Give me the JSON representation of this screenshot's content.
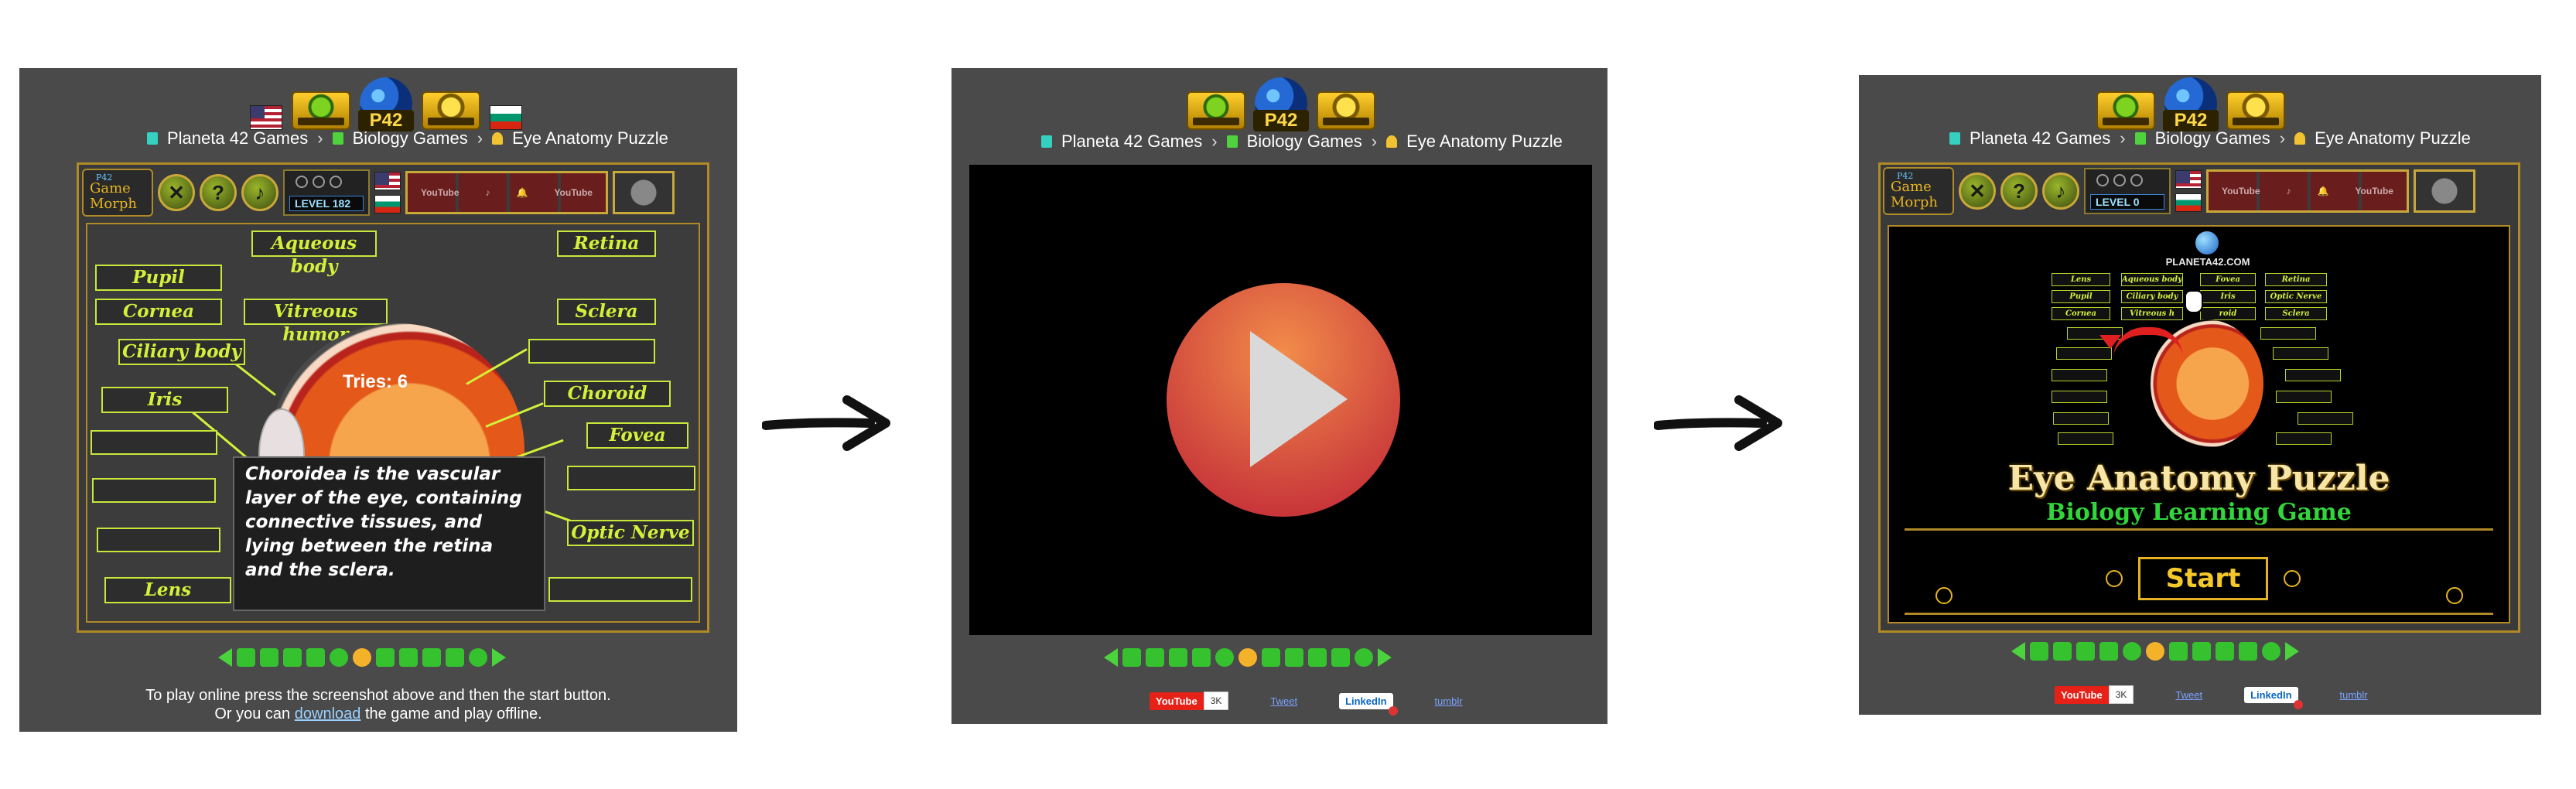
{
  "breadcrumb": {
    "item1": "Planeta 42 Games",
    "item2": "Biology Games",
    "item3": "Eye Anatomy Puzzle",
    "sep": "›"
  },
  "logo_text": "P42",
  "gamemorph": {
    "tag": "P42",
    "line1": "Game",
    "line2": "Morph",
    "btn_close": "✕",
    "btn_help": "?",
    "btn_music": "♪",
    "level_p1": "LEVEL 182",
    "level_p3": "LEVEL 0",
    "media1": "YouTube",
    "media2": "YouTube"
  },
  "panel1": {
    "labels": {
      "aqueous": "Aqueous body",
      "retina": "Retina",
      "pupil": "Pupil",
      "cornea": "Cornea",
      "vitreous": "Vitreous humor",
      "sclera": "Sclera",
      "ciliary": "Ciliary body",
      "choroid": "Choroid",
      "iris": "Iris",
      "fovea": "Fovea",
      "optic": "Optic Nerve",
      "lens": "Lens"
    },
    "tries_label": "Tries:",
    "tries_value": "6",
    "tooltip": "Choroidea is the vascular layer of the eye, containing connective tissues, and lying between the retina and the sclera.",
    "info_line1": "To play online press the screenshot above and then the start button.",
    "info_line2_pre": "Or you can",
    "info_line2_link": "download",
    "info_line2_post": "the game and play offline."
  },
  "share": {
    "youtube": "YouTube",
    "youtube_count": "3K",
    "tweet": "Tweet",
    "linkedin": "LinkedIn",
    "tumblr": "tumblr"
  },
  "panel3": {
    "p42": "PLANETA42.COM",
    "mini_labels": {
      "lens": "Lens",
      "aqueous": "Aqueous body",
      "fovea": "Fovea",
      "retina": "Retina",
      "pupil": "Pupil",
      "ciliary": "Ciliary body",
      "iris": "Iris",
      "optic": "Optic Nerve",
      "cornea": "Cornea",
      "vitreous": "Vitreous h",
      "choroid": "roid",
      "sclera": "Sclera"
    },
    "title": "Eye Anatomy Puzzle",
    "subtitle": "Biology Learning Game",
    "start": "Start"
  }
}
